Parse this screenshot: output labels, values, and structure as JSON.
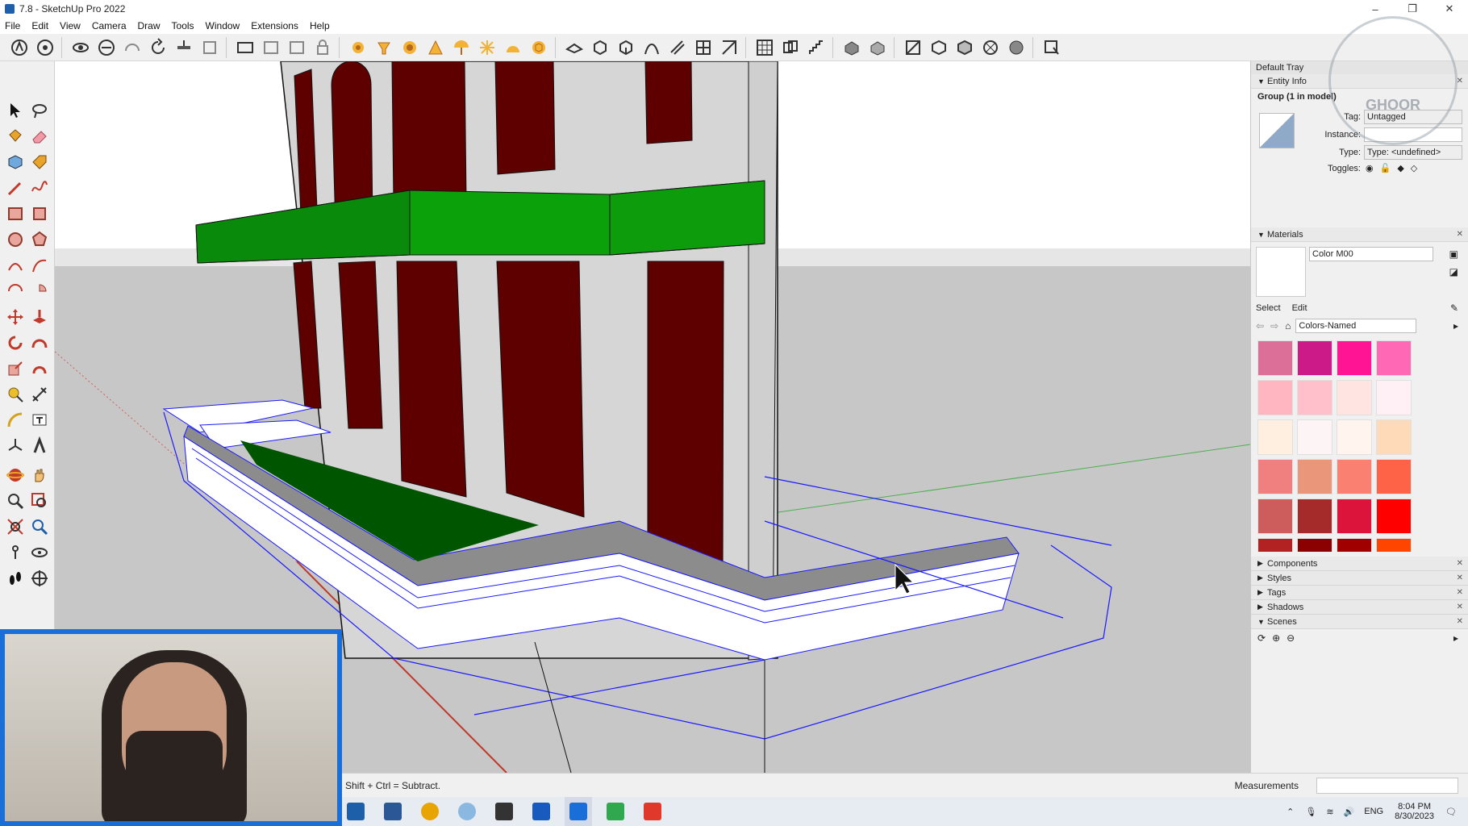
{
  "window": {
    "title": "7.8 - SketchUp Pro 2022",
    "controls": [
      "–",
      "❐",
      "✕"
    ]
  },
  "menu": [
    "File",
    "Edit",
    "View",
    "Camera",
    "Draw",
    "Tools",
    "Window",
    "Extensions",
    "Help"
  ],
  "status": {
    "hint": "Shift + Ctrl = Subtract.",
    "measurements_label": "Measurements",
    "measurements_value": ""
  },
  "tray": {
    "title": "Default Tray",
    "entity_info": {
      "header": "Entity Info",
      "selection": "Group (1 in model)",
      "tag_label": "Tag:",
      "tag_value": "Untagged",
      "instance_label": "Instance:",
      "instance_value": "",
      "type_label": "Type:",
      "type_value": "Type: <undefined>",
      "toggles_label": "Toggles:"
    },
    "materials": {
      "header": "Materials",
      "material_name": "Color M00",
      "tab_select": "Select",
      "tab_edit": "Edit",
      "library": "Colors-Named",
      "swatches": [
        "#dc6f98",
        "#cc1a88",
        "#ff1493",
        "#ff68b4",
        "#ffb6c1",
        "#ffc0cb",
        "#ffe4e1",
        "#fff0f5",
        "#ffefe0",
        "#fdf5f5",
        "#fff5ee",
        "#ffdab9",
        "#f08080",
        "#e9967a",
        "#fa8072",
        "#ff6347",
        "#cd5c5c",
        "#a52a2a",
        "#dc143c",
        "#ff0000",
        "#b22222",
        "#8b0000",
        "#a00000",
        "#ff4500"
      ]
    },
    "collapsed_panels": [
      "Components",
      "Styles",
      "Tags",
      "Shadows"
    ],
    "scenes_header": "Scenes"
  },
  "taskbar": {
    "apps": [
      "Start",
      "Mail",
      "Chrome",
      "Explorer",
      "Calculator",
      "Word",
      "SketchUp",
      "Camtasia",
      "Recorder"
    ],
    "language": "ENG",
    "time": "8:04 PM",
    "date": "8/30/2023"
  },
  "watermark": "GHOOR"
}
